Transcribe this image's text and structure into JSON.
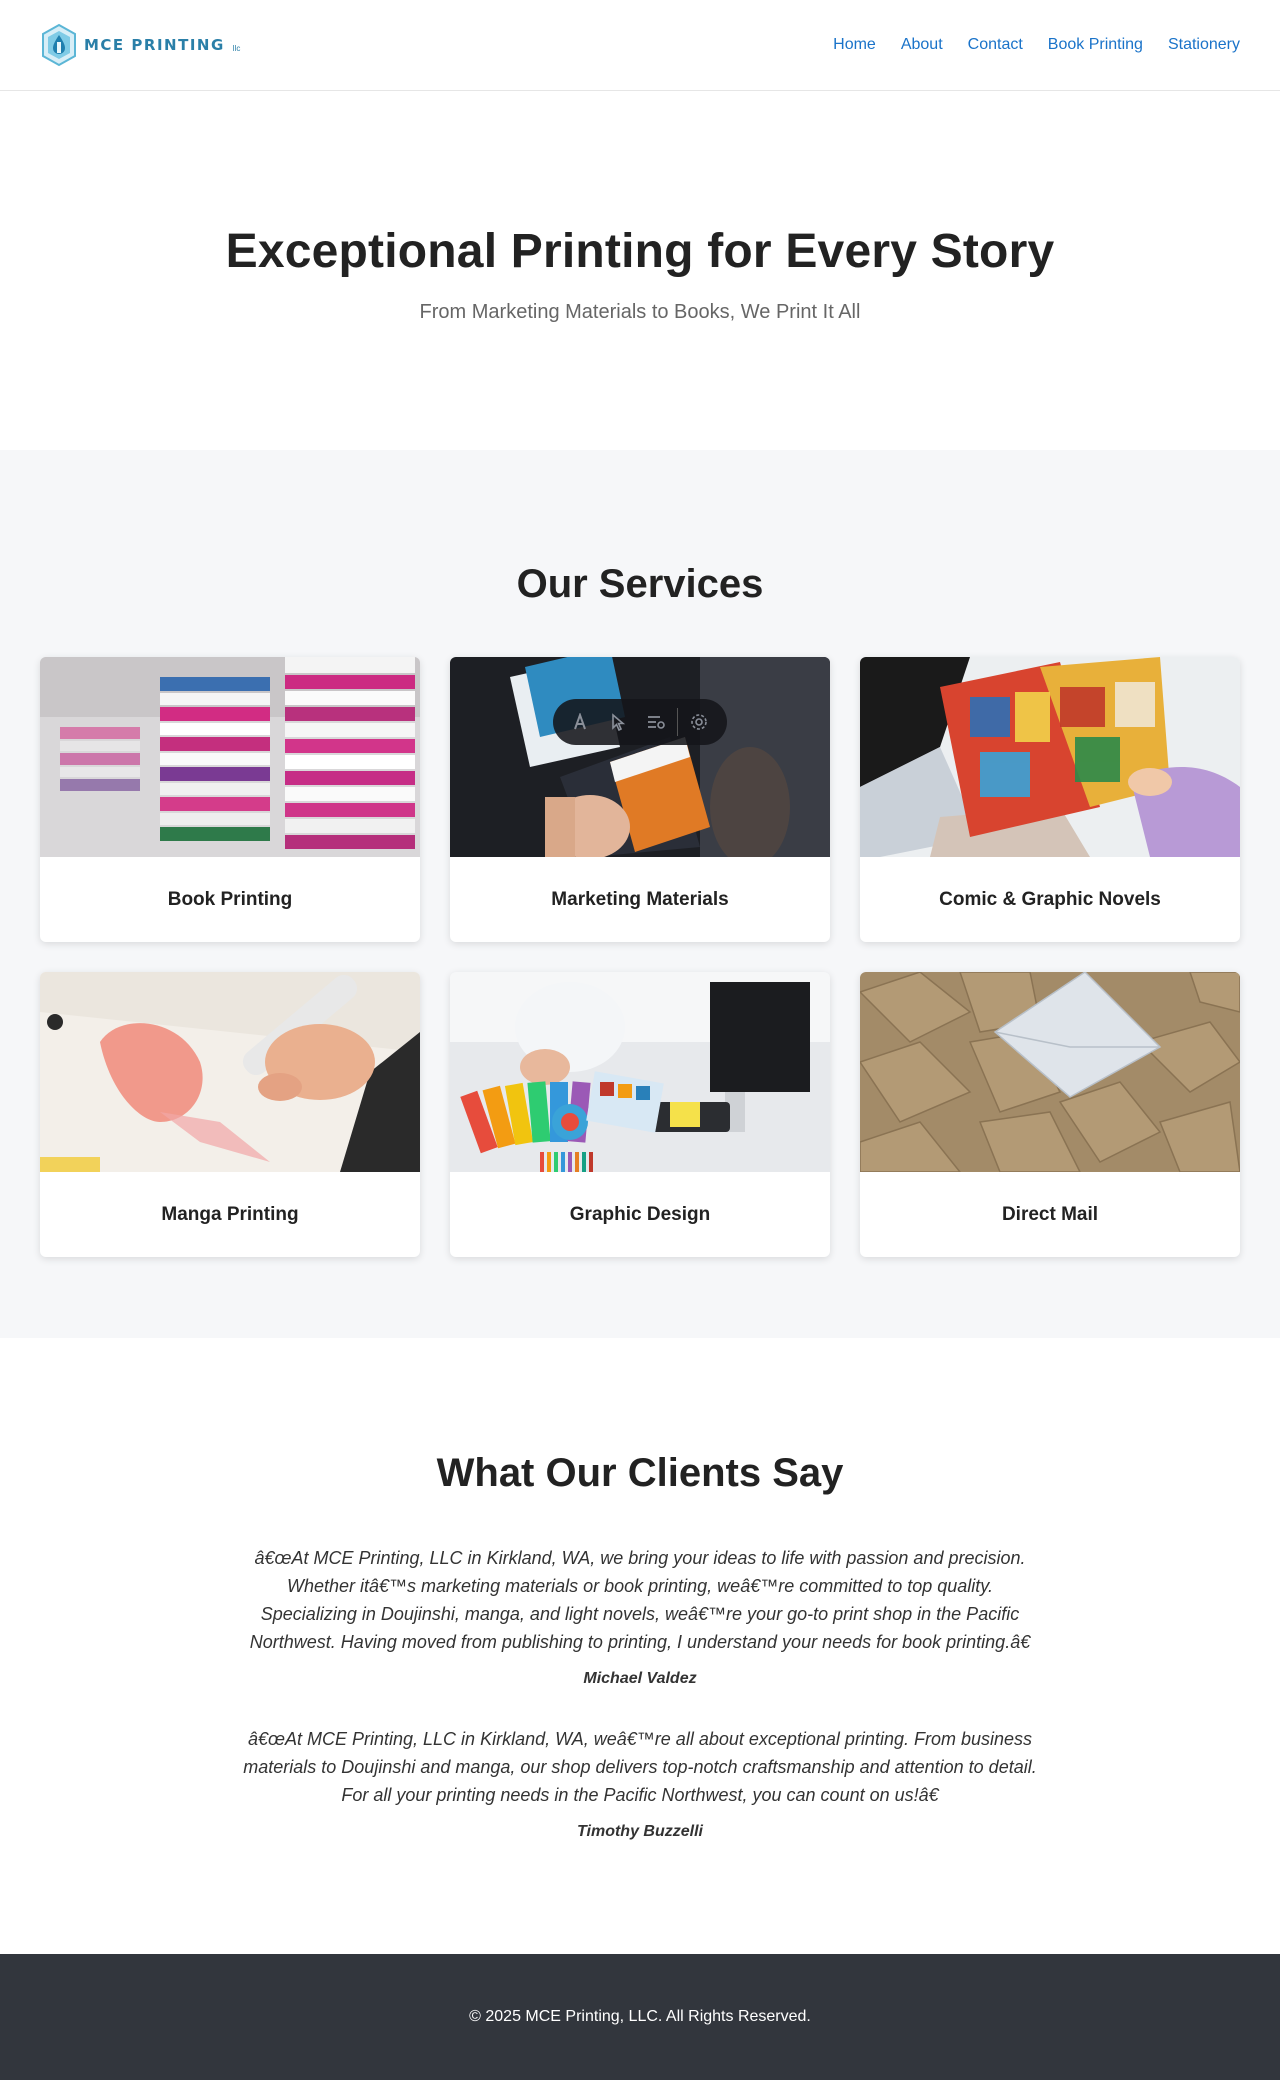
{
  "brand": {
    "name": "MCE PRINTING",
    "suffix": "llc",
    "color": "#2a7fa8"
  },
  "nav": [
    {
      "label": "Home"
    },
    {
      "label": "About"
    },
    {
      "label": "Contact"
    },
    {
      "label": "Book Printing"
    },
    {
      "label": "Stationery"
    }
  ],
  "hero": {
    "title": "Exceptional Printing for Every Story",
    "subtitle": "From Marketing Materials to Books, We Print It All"
  },
  "services": {
    "title": "Our Services",
    "items": [
      {
        "label": "Book Printing",
        "image": "stacked-books-photo"
      },
      {
        "label": "Marketing Materials",
        "image": "brochures-photo"
      },
      {
        "label": "Comic & Graphic Novels",
        "image": "comic-book-photo"
      },
      {
        "label": "Manga Printing",
        "image": "manga-drawing-photo"
      },
      {
        "label": "Graphic Design",
        "image": "color-swatches-photo"
      },
      {
        "label": "Direct Mail",
        "image": "envelopes-photo"
      }
    ]
  },
  "testimonials": {
    "title": "What Our Clients Say",
    "items": [
      {
        "quote": "â€œAt MCE Printing, LLC in Kirkland, WA, we bring your ideas to life with passion and precision. Whether itâ€™s marketing materials or book printing, weâ€™re committed to top quality. Specializing in Doujinshi, manga, and light novels, weâ€™re your go-to print shop in the Pacific Northwest. Having moved from publishing to printing, I understand your needs for book printing.â€",
        "author": "Michael Valdez"
      },
      {
        "quote": "â€œAt MCE Printing, LLC in Kirkland, WA, weâ€™re all about exceptional printing. From business materials to Doujinshi and manga, our shop delivers top-notch craftsmanship and attention to detail. For all your printing needs in the Pacific Northwest, you can count on us!â€",
        "author": "Timothy Buzzelli"
      }
    ]
  },
  "footer": {
    "copyright": "© 2025 MCE Printing, LLC. All Rights Reserved."
  },
  "toolbar": {
    "icons": [
      "text-style-icon",
      "cursor-icon",
      "list-settings-icon",
      "gear-icon"
    ]
  },
  "colors": {
    "link": "#1a73c9",
    "services_bg": "#f6f7f9",
    "footer_bg": "#32363d"
  }
}
